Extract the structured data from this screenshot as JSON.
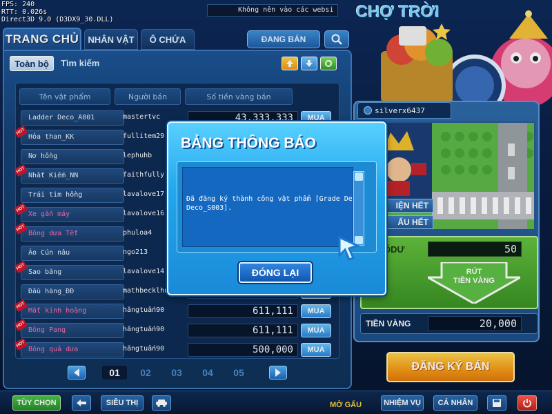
{
  "debug": {
    "fps": "FPS: 240",
    "rtt": "RTT: 0.026s",
    "renderer": "Direct3D 9.0 (D3DX9_30.DLL)"
  },
  "marquee": "Không nên vào các websi",
  "tabs": {
    "home": "TRANG CHỦ",
    "character": "NHÂN VẬT",
    "slot": "Ô CHỨA",
    "selling": "ĐANG BÁN"
  },
  "subtabs": {
    "all": "Toàn bộ",
    "search": "Tìm kiếm"
  },
  "table": {
    "headers": {
      "name": "Tên vật phẩm",
      "seller": "Người bán",
      "price": "Số tiền vàng bán"
    },
    "buy_label": "MUA",
    "hot_label": "HOT",
    "rows": [
      {
        "name": "Ladder Deco_A001",
        "seller": "mastertvc",
        "price": "43,333,333",
        "hot": false,
        "pink": false
      },
      {
        "name": "Hỏa than_KK",
        "seller": "fullitem29",
        "price": "",
        "hot": true,
        "pink": false
      },
      {
        "name": "Nơ hồng",
        "seller": "lephuhb",
        "price": "",
        "hot": false,
        "pink": false
      },
      {
        "name": "Nhất Kiếm_NN",
        "seller": "faithfully",
        "price": "",
        "hot": true,
        "pink": false
      },
      {
        "name": "Trái tim hồng",
        "seller": "lavalove17",
        "price": "",
        "hot": false,
        "pink": false
      },
      {
        "name": "Xe gắn máy",
        "seller": "lavalove16",
        "price": "",
        "hot": true,
        "pink": true
      },
      {
        "name": "Bông dưa Tết",
        "seller": "phuloa4",
        "price": "",
        "hot": true,
        "pink": true
      },
      {
        "name": "Áo Cún nâu",
        "seller": "ngo213",
        "price": "",
        "hot": false,
        "pink": false
      },
      {
        "name": "Sao băng",
        "seller": "lavalove14",
        "price": "",
        "hot": true,
        "pink": false
      },
      {
        "name": "Đầu hàng_ĐĐ",
        "seller": "mathbecklhn",
        "price": "",
        "hot": false,
        "pink": false
      },
      {
        "name": "Mắt kính hoàng",
        "seller": "hằngtuấn90",
        "price": "611,111",
        "hot": true,
        "pink": true
      },
      {
        "name": "Bông Pang",
        "seller": "hằngtuấn90",
        "price": "611,111",
        "hot": true,
        "pink": true
      },
      {
        "name": "Bông quả dưa",
        "seller": "hằngtuấn90",
        "price": "500,000",
        "hot": true,
        "pink": true
      }
    ]
  },
  "pagination": {
    "pages": [
      "01",
      "02",
      "03",
      "04",
      "05"
    ],
    "current": "01"
  },
  "right": {
    "title": "CHỢ TRỜI",
    "username": "silverx6437",
    "btn1": "IỆN HẾT",
    "btn2": "ẤU HẾT",
    "balance_label": "ỐDƯ",
    "balance_value": "50",
    "withdraw_line1": "RÚT",
    "withdraw_line2": "TIỀN VÀNG",
    "gold_label": "TIỀN VÀNG",
    "gold_value": "20,000",
    "register": "ĐĂNG KÝ BÁN"
  },
  "bottom": {
    "options": "TÙY CHỌN",
    "supermarket": "SIÊU THỊ",
    "bear": "MỞ GẤU",
    "quest": "NHIỆM VỤ",
    "profile": "CÁ NHÂN"
  },
  "modal": {
    "title": "BẢNG THÔNG BÁO",
    "message": "Đã đăng ký thành công vật phẩm [Grade De Deco_S003].",
    "close": "ĐÓNG LẠI"
  }
}
